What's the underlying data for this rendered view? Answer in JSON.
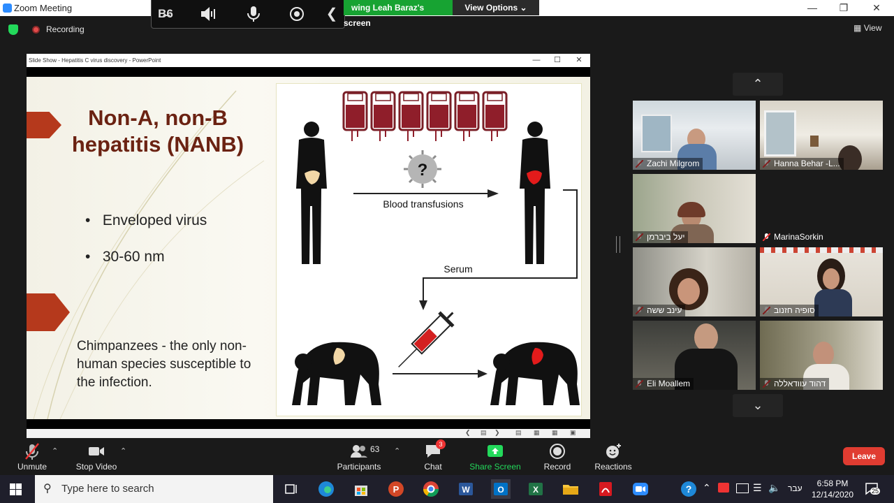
{
  "app": {
    "title": "Zoom Meeting"
  },
  "share_bar": {
    "viewing_label": "wing Leah Baraz's screen",
    "view_options_label": "View Options"
  },
  "status": {
    "recording_label": "Recording",
    "view_label": "View"
  },
  "presentation": {
    "window_title": "Slide Show  -  Hepatitis C virus discovery  -  PowerPoint",
    "slide": {
      "title_line1": "Non-A, non-B",
      "title_line2": "hepatitis (NANB)",
      "bullets": [
        "Enveloped virus",
        "30-60 nm"
      ],
      "note": "Chimpanzees - the only non-human species susceptible to the infection."
    },
    "diagram": {
      "transfusion_label": "Blood transfusions",
      "serum_label": "Serum",
      "unknown_symbol": "?"
    }
  },
  "participants": [
    {
      "name": "Zachi Milgrom"
    },
    {
      "name": "Hanna Behar -L..."
    },
    {
      "name": "יעל ביברמן"
    },
    {
      "name": "MarinaSorkin"
    },
    {
      "name": "עינב ששה"
    },
    {
      "name": "סופיה חזנוב"
    },
    {
      "name": "Eli Moallem"
    },
    {
      "name": "דהוד עוודאללה"
    }
  ],
  "toolbar": {
    "unmute_label": "Unmute",
    "stop_video_label": "Stop Video",
    "participants_label": "Participants",
    "participants_count": "63",
    "chat_label": "Chat",
    "chat_badge": "3",
    "share_screen_label": "Share Screen",
    "record_label": "Record",
    "reactions_label": "Reactions",
    "leave_label": "Leave"
  },
  "taskbar": {
    "search_placeholder": "Type here to search",
    "language": "עבר",
    "time": "6:58 PM",
    "date": "12/14/2020",
    "notification_count": "25"
  },
  "colors": {
    "accent": "#2d8cff",
    "share_green": "#17a332",
    "leave_red": "#e03c31",
    "slide_title": "#6b2212",
    "slide_arrow": "#b5391c"
  }
}
